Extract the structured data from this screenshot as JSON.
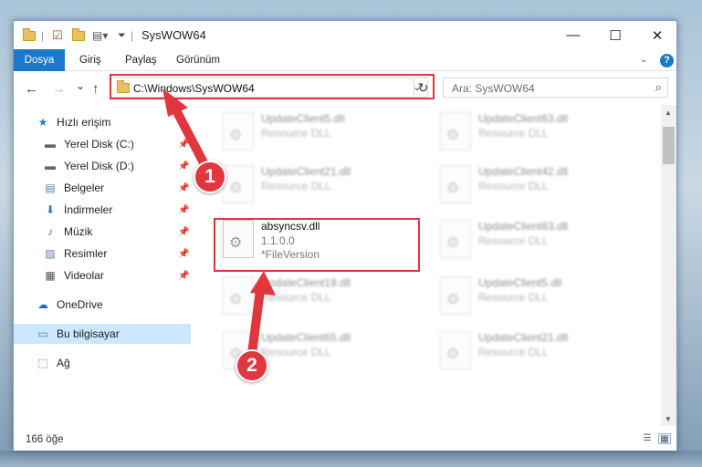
{
  "window": {
    "title": "SysWOW64",
    "controls": {
      "minimize": "—",
      "maximize": "☐",
      "close": "✕"
    }
  },
  "ribbon": {
    "tabs": [
      "Dosya",
      "Giriş",
      "Paylaş",
      "Görünüm"
    ],
    "help": "?"
  },
  "nav": {
    "back": "←",
    "forward": "→",
    "recent": "⌄",
    "up": "↑",
    "address": "C:\\Windows\\SysWOW64",
    "refresh": "↻",
    "search_placeholder": "Ara: SysWOW64"
  },
  "sidebar": {
    "items": [
      {
        "label": "Hızlı erişim",
        "icon": "★",
        "pinned": false
      },
      {
        "label": "Yerel Disk (C:)",
        "icon": "▬",
        "pinned": true
      },
      {
        "label": "Yerel Disk (D:)",
        "icon": "▬",
        "pinned": true
      },
      {
        "label": "Belgeler",
        "icon": "▤",
        "pinned": true
      },
      {
        "label": "İndirmeler",
        "icon": "⬇",
        "pinned": true
      },
      {
        "label": "Müzik",
        "icon": "♪",
        "pinned": true
      },
      {
        "label": "Resimler",
        "icon": "▨",
        "pinned": true
      },
      {
        "label": "Videolar",
        "icon": "▦",
        "pinned": true
      },
      {
        "label": "OneDrive",
        "icon": "☁",
        "pinned": false
      },
      {
        "label": "Bu bilgisayar",
        "icon": "▭",
        "pinned": false,
        "selected": true
      },
      {
        "label": "Ağ",
        "icon": "⬚",
        "pinned": false
      }
    ],
    "pin_glyph": "📌"
  },
  "files": {
    "left": [
      {
        "name": "UpdateClient5.dll",
        "type": "Resource DLL"
      },
      {
        "name": "UpdateClient21.dll",
        "type": "Resource DLL"
      },
      {
        "name": "absyncsv.dll",
        "type": "1.1.0.0",
        "version": "*FileVersion",
        "highlight": true
      },
      {
        "name": "UpdateClient19.dll",
        "type": "Resource DLL"
      },
      {
        "name": "UpdateClient65.dll",
        "type": "Resource DLL"
      }
    ],
    "right": [
      {
        "name": "UpdateClient63.dll",
        "type": "Resource DLL"
      },
      {
        "name": "UpdateClient42.dll",
        "type": "Resource DLL"
      },
      {
        "name": "UpdateClient63.dll",
        "type": "Resource DLL"
      },
      {
        "name": "UpdateClient5.dll",
        "type": "Resource DLL"
      },
      {
        "name": "UpdateClient21.dll",
        "type": "Resource DLL"
      }
    ]
  },
  "status": {
    "count": "166 öğe"
  },
  "annotations": {
    "badge1": "1",
    "badge2": "2",
    "color": "#e0363e"
  }
}
